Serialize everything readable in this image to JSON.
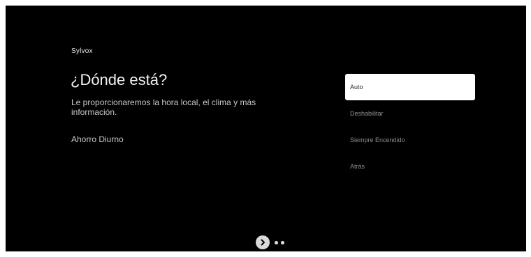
{
  "brand": "Sylvox",
  "title": "¿Dónde está?",
  "subtitle": "Le proporcionaremos la hora local, el clima y más información.",
  "setting_name": "Ahorro Diurno",
  "options": [
    {
      "label": "Auto",
      "selected": true
    },
    {
      "label": "Deshabilitar",
      "selected": false
    },
    {
      "label": "Siempre Encendido",
      "selected": false
    },
    {
      "label": "Atrás",
      "selected": false
    }
  ],
  "pager": {
    "next_icon": "chevron-right-icon",
    "total_dots": 2
  },
  "colors": {
    "background": "#000000",
    "selected_option_bg": "#ffffff",
    "option_text": "#8f8f8f"
  }
}
